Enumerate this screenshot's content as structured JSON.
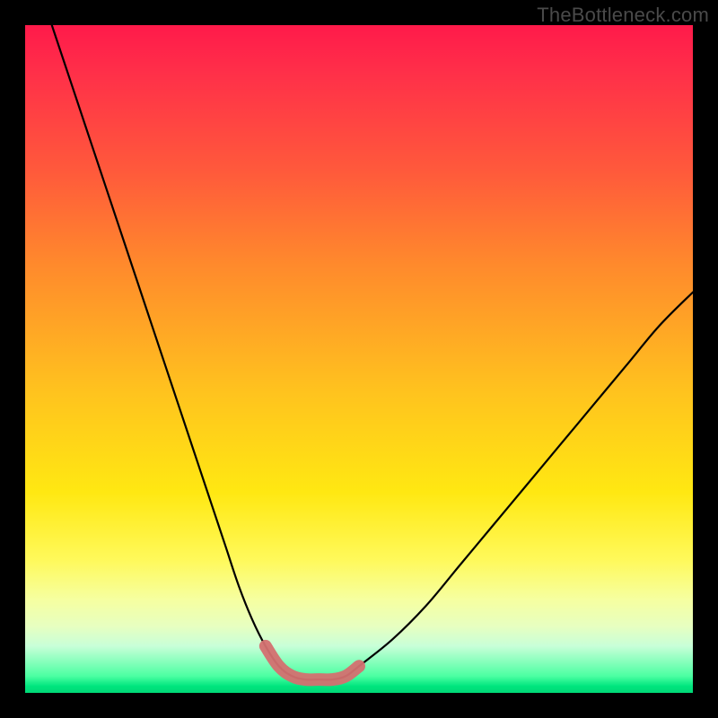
{
  "watermark": "TheBottleneck.com",
  "colors": {
    "gradient_top": "#ff1a4a",
    "gradient_mid_orange": "#ff8a2c",
    "gradient_mid_yellow": "#ffe812",
    "gradient_bottom_green": "#00d877",
    "curve_stroke": "#000000",
    "highlight_stroke": "#d47070"
  },
  "chart_data": {
    "type": "line",
    "title": "",
    "xlabel": "",
    "ylabel": "",
    "xlim": [
      0,
      100
    ],
    "ylim": [
      0,
      100
    ],
    "grid": false,
    "legend": false,
    "series": [
      {
        "name": "bottleneck-curve",
        "x": [
          4,
          6,
          8,
          10,
          12,
          14,
          16,
          18,
          20,
          22,
          24,
          26,
          28,
          30,
          32,
          34,
          36,
          38,
          40,
          42,
          44,
          46,
          48,
          50,
          55,
          60,
          65,
          70,
          75,
          80,
          85,
          90,
          95,
          100
        ],
        "y": [
          100,
          94,
          88,
          82,
          76,
          70,
          64,
          58,
          52,
          46,
          40,
          34,
          28,
          22,
          16,
          11,
          7,
          4,
          2.5,
          2,
          2,
          2,
          2.5,
          4,
          8,
          13,
          19,
          25,
          31,
          37,
          43,
          49,
          55,
          60
        ]
      },
      {
        "name": "highlighted-minimum-segment",
        "x": [
          36,
          38,
          40,
          42,
          44,
          46,
          48,
          50
        ],
        "y": [
          7,
          4,
          2.5,
          2,
          2,
          2,
          2.5,
          4
        ]
      }
    ],
    "annotations": []
  }
}
